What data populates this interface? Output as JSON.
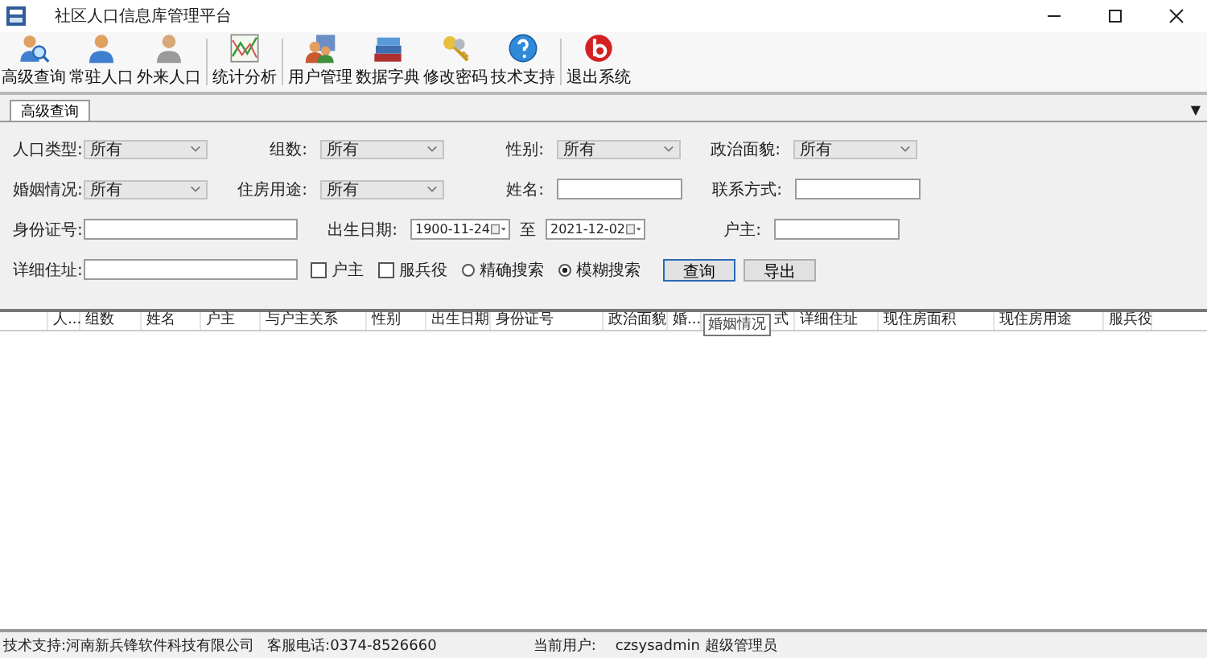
{
  "window": {
    "title": "社区人口信息库管理平台"
  },
  "toolbar": {
    "groups": [
      [
        "高级查询",
        "常驻人口",
        "外来人口"
      ],
      [
        "统计分析"
      ],
      [
        "用户管理",
        "数据字典",
        "修改密码",
        "技术支持"
      ],
      [
        "退出系统"
      ]
    ]
  },
  "tabs": [
    {
      "label": "高级查询",
      "selected": true
    }
  ],
  "tab_menu": "▼",
  "form": {
    "rows": [
      [
        {
          "kind": "select",
          "label": "人口类型:",
          "value": "所有"
        },
        {
          "kind": "select",
          "label": "组数:",
          "value": "所有"
        },
        {
          "kind": "select",
          "label": "性别:",
          "value": "所有"
        },
        {
          "kind": "select",
          "label": "政治面貌:",
          "value": "所有"
        }
      ],
      [
        {
          "kind": "select",
          "label": "婚姻情况:",
          "value": "所有"
        },
        {
          "kind": "select",
          "label": "住房用途:",
          "value": "所有"
        },
        {
          "kind": "input",
          "label": "姓名:"
        },
        {
          "kind": "input",
          "label": "联系方式:"
        }
      ],
      [
        {
          "kind": "wide",
          "label": "身份证号:"
        },
        {
          "kind": "dates",
          "label": "出生日期:",
          "from": "1900-11-24",
          "sep": "至",
          "to": "2021-12-02"
        },
        {
          "kind": "input",
          "label": "户主:"
        }
      ],
      [
        {
          "kind": "wide",
          "label": "详细住址:"
        },
        {
          "kind": "options",
          "checks": [
            {
              "label": "户主",
              "checked": false
            },
            {
              "label": "服兵役",
              "checked": false
            }
          ],
          "radios": [
            {
              "label": "精确搜索",
              "selected": false
            },
            {
              "label": "模糊搜索",
              "selected": true
            }
          ]
        },
        {
          "kind": "buttons",
          "buttons": [
            {
              "label": "查询",
              "selected": true
            },
            {
              "label": "导出",
              "selected": false
            }
          ]
        }
      ]
    ]
  },
  "table": {
    "columns": [
      "人...",
      "组数",
      "姓名",
      "户主",
      "与户主关系",
      "性别",
      "出生日期",
      "身份证号",
      "政治面貌",
      "婚...",
      "式",
      "详细住址",
      "现住房面积",
      "现住房用途",
      "服兵役"
    ],
    "tooltip": "婚姻情况"
  },
  "status_bar": {
    "support": "技术支持:河南新兵锋软件科技有限公司",
    "phone": "客服电话:0374-8526660",
    "user_label": "当前用户:",
    "user": "czsysadmin 超级管理员"
  }
}
